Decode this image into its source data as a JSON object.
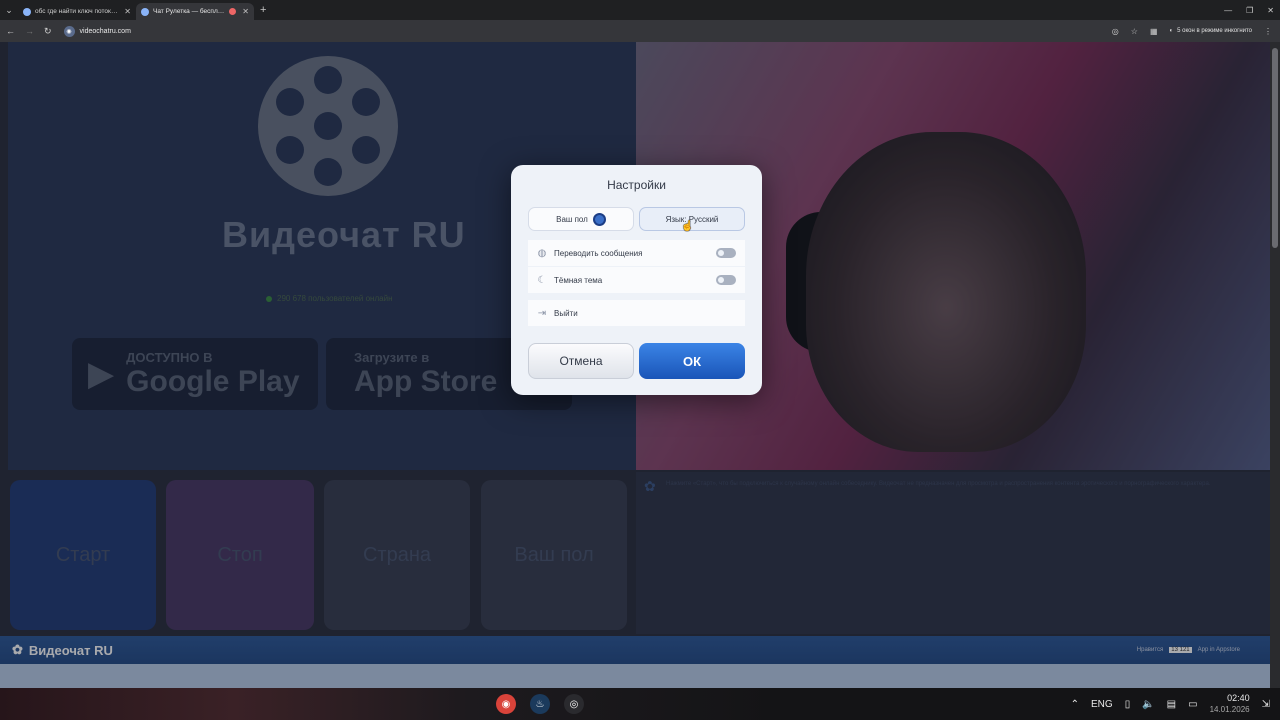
{
  "browser": {
    "tabs": [
      {
        "title": "обс где найти ключ потока ю..."
      },
      {
        "title": "Чат Рулетка — бесплатный..."
      }
    ],
    "url": "videochatru.com",
    "incognito_label": "5 окон в режиме инкогнито"
  },
  "hero": {
    "title": "Видеочат RU",
    "online": "290 678 пользователей онлайн",
    "google_play_top": "ДОСТУПНО В",
    "google_play_bottom": "Google Play",
    "app_store_top": "Загрузите в",
    "app_store_bottom": "App Store"
  },
  "tiles": {
    "start": "Старт",
    "stop": "Стоп",
    "country": "Страна",
    "gender": "Ваш пол"
  },
  "chat": {
    "notice": "Нажмите «Старт», что бы подключиться к случайному онлайн собеседнику. Видеочат не предназначен для просмотра и распространения контента эротического и порнографического характера."
  },
  "footer": {
    "brand": "Видеочат RU",
    "likes_label": "Нравится",
    "likes_count": "13 121",
    "app_label": "App in Appstore"
  },
  "modal": {
    "title": "Настройки",
    "gender_label": "Ваш пол",
    "language_label": "Язык: Русский",
    "translate_label": "Переводить сообщения",
    "dark_theme_label": "Тёмная тема",
    "logout_label": "Выйти",
    "cancel_label": "Отмена",
    "ok_label": "ОК",
    "translate_enabled": false,
    "dark_theme_enabled": false
  },
  "taskbar": {
    "language": "ENG",
    "time": "02:40",
    "date": "14.01.2026"
  },
  "colors": {
    "ok_button": "#1f5fc4",
    "footer_bar": "#2b579a",
    "modal_bg": "#eef2f8"
  }
}
